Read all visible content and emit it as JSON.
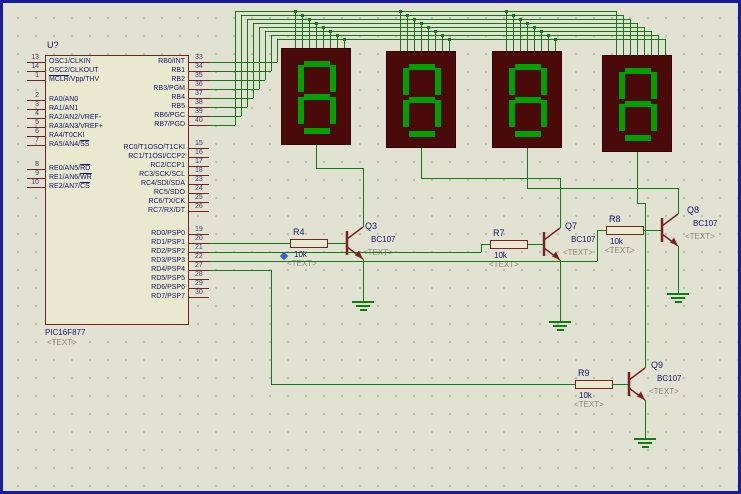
{
  "schematic": {
    "chip": {
      "ref": "U?",
      "part": "PIC16F877",
      "placeholder": "<TEXT>",
      "left_pins": [
        {
          "num": "13",
          "parts": [
            {
              "t": "OSC1/CLKIN"
            }
          ]
        },
        {
          "num": "14",
          "parts": [
            {
              "t": "OSC2/CLKOUT"
            }
          ]
        },
        {
          "num": "1",
          "parts": [
            {
              "t": "MCLR",
              "ov": true
            },
            {
              "t": "/Vpp/THV"
            }
          ]
        },
        {
          "num": "2",
          "parts": [
            {
              "t": "RA0/AN0"
            }
          ]
        },
        {
          "num": "3",
          "parts": [
            {
              "t": "RA1/AN1"
            }
          ]
        },
        {
          "num": "4",
          "parts": [
            {
              "t": "RA2/AN2/VREF-"
            }
          ]
        },
        {
          "num": "5",
          "parts": [
            {
              "t": "RA3/AN3/VREF+"
            }
          ]
        },
        {
          "num": "6",
          "parts": [
            {
              "t": "RA4/T0CKI"
            }
          ]
        },
        {
          "num": "7",
          "parts": [
            {
              "t": "RA5/AN4/"
            },
            {
              "t": "SS",
              "ov": true
            }
          ]
        },
        {
          "num": "8",
          "parts": [
            {
              "t": "RE0/AN5/"
            },
            {
              "t": "RD",
              "ov": true
            }
          ]
        },
        {
          "num": "9",
          "parts": [
            {
              "t": "RE1/AN6/"
            },
            {
              "t": "WR",
              "ov": true
            }
          ]
        },
        {
          "num": "10",
          "parts": [
            {
              "t": "RE2/AN7/"
            },
            {
              "t": "CS",
              "ov": true
            }
          ]
        }
      ],
      "right_pins": [
        {
          "num": "33",
          "parts": [
            {
              "t": "RB0/INT"
            }
          ]
        },
        {
          "num": "34",
          "parts": [
            {
              "t": "RB1"
            }
          ]
        },
        {
          "num": "35",
          "parts": [
            {
              "t": "RB2"
            }
          ]
        },
        {
          "num": "36",
          "parts": [
            {
              "t": "RB3/PGM"
            }
          ]
        },
        {
          "num": "37",
          "parts": [
            {
              "t": "RB4"
            }
          ]
        },
        {
          "num": "38",
          "parts": [
            {
              "t": "RB5"
            }
          ]
        },
        {
          "num": "39",
          "parts": [
            {
              "t": "RB6/PGC"
            }
          ]
        },
        {
          "num": "40",
          "parts": [
            {
              "t": "RB7/PGD"
            }
          ]
        },
        {
          "num": "15",
          "parts": [
            {
              "t": "RC0/T1OSO/T1CKI"
            }
          ]
        },
        {
          "num": "16",
          "parts": [
            {
              "t": "RC1/T1OSI/CCP2"
            }
          ]
        },
        {
          "num": "17",
          "parts": [
            {
              "t": "RC2/CCP1"
            }
          ]
        },
        {
          "num": "18",
          "parts": [
            {
              "t": "RC3/SCK/SCL"
            }
          ]
        },
        {
          "num": "23",
          "parts": [
            {
              "t": "RC4/SDI/SDA"
            }
          ]
        },
        {
          "num": "24",
          "parts": [
            {
              "t": "RC5/SDO"
            }
          ]
        },
        {
          "num": "25",
          "parts": [
            {
              "t": "RC6/TX/CK"
            }
          ]
        },
        {
          "num": "26",
          "parts": [
            {
              "t": "RC7/RX/DT"
            }
          ]
        },
        {
          "num": "19",
          "parts": [
            {
              "t": "RD0/PSP0"
            }
          ]
        },
        {
          "num": "20",
          "parts": [
            {
              "t": "RD1/PSP1"
            }
          ]
        },
        {
          "num": "21",
          "parts": [
            {
              "t": "RD2/PSP2"
            }
          ]
        },
        {
          "num": "22",
          "parts": [
            {
              "t": "RD3/PSP3"
            }
          ]
        },
        {
          "num": "27",
          "parts": [
            {
              "t": "RD4/PSP4"
            }
          ]
        },
        {
          "num": "28",
          "parts": [
            {
              "t": "RD5/PSP5"
            }
          ]
        },
        {
          "num": "29",
          "parts": [
            {
              "t": "RD6/PSP6"
            }
          ]
        },
        {
          "num": "30",
          "parts": [
            {
              "t": "RD7/PSP7"
            }
          ]
        }
      ]
    },
    "displays": [
      {
        "digit": "8"
      },
      {
        "digit": "8"
      },
      {
        "digit": "8"
      },
      {
        "digit": "8"
      }
    ],
    "driver_stages": [
      {
        "resistor": {
          "ref": "R4",
          "value": "10k",
          "placeholder": "<TEXT>"
        },
        "transistor": {
          "ref": "Q3",
          "part": "BC107",
          "placeholder": "<TEXT>"
        }
      },
      {
        "resistor": {
          "ref": "R7",
          "value": "10k",
          "placeholder": "<TEXT>"
        },
        "transistor": {
          "ref": "Q7",
          "part": "BC107",
          "placeholder": "<TEXT>"
        }
      },
      {
        "resistor": {
          "ref": "R8",
          "value": "10k",
          "placeholder": "<TEXT>"
        },
        "transistor": {
          "ref": "Q8",
          "part": "BC107",
          "placeholder": "<TEXT>"
        }
      },
      {
        "resistor": {
          "ref": "R9",
          "value": "10k",
          "placeholder": "<TEXT>"
        },
        "transistor": {
          "ref": "Q9",
          "part": "BC107",
          "placeholder": "<TEXT>"
        }
      }
    ],
    "colors": {
      "wire": "#0f7d0f",
      "component_outline": "#7a2222",
      "component_fill": "#e9e9cf",
      "label": "#16166e",
      "placeholder_text": "#8f8474",
      "display_bg": "#4b0a0a",
      "display_segment": "#00a000",
      "grid_dot": "#bdbdad",
      "canvas_bg": "#e2e2d2",
      "border": "#1b1b9e",
      "origin_marker": "#3a5fd0"
    }
  }
}
